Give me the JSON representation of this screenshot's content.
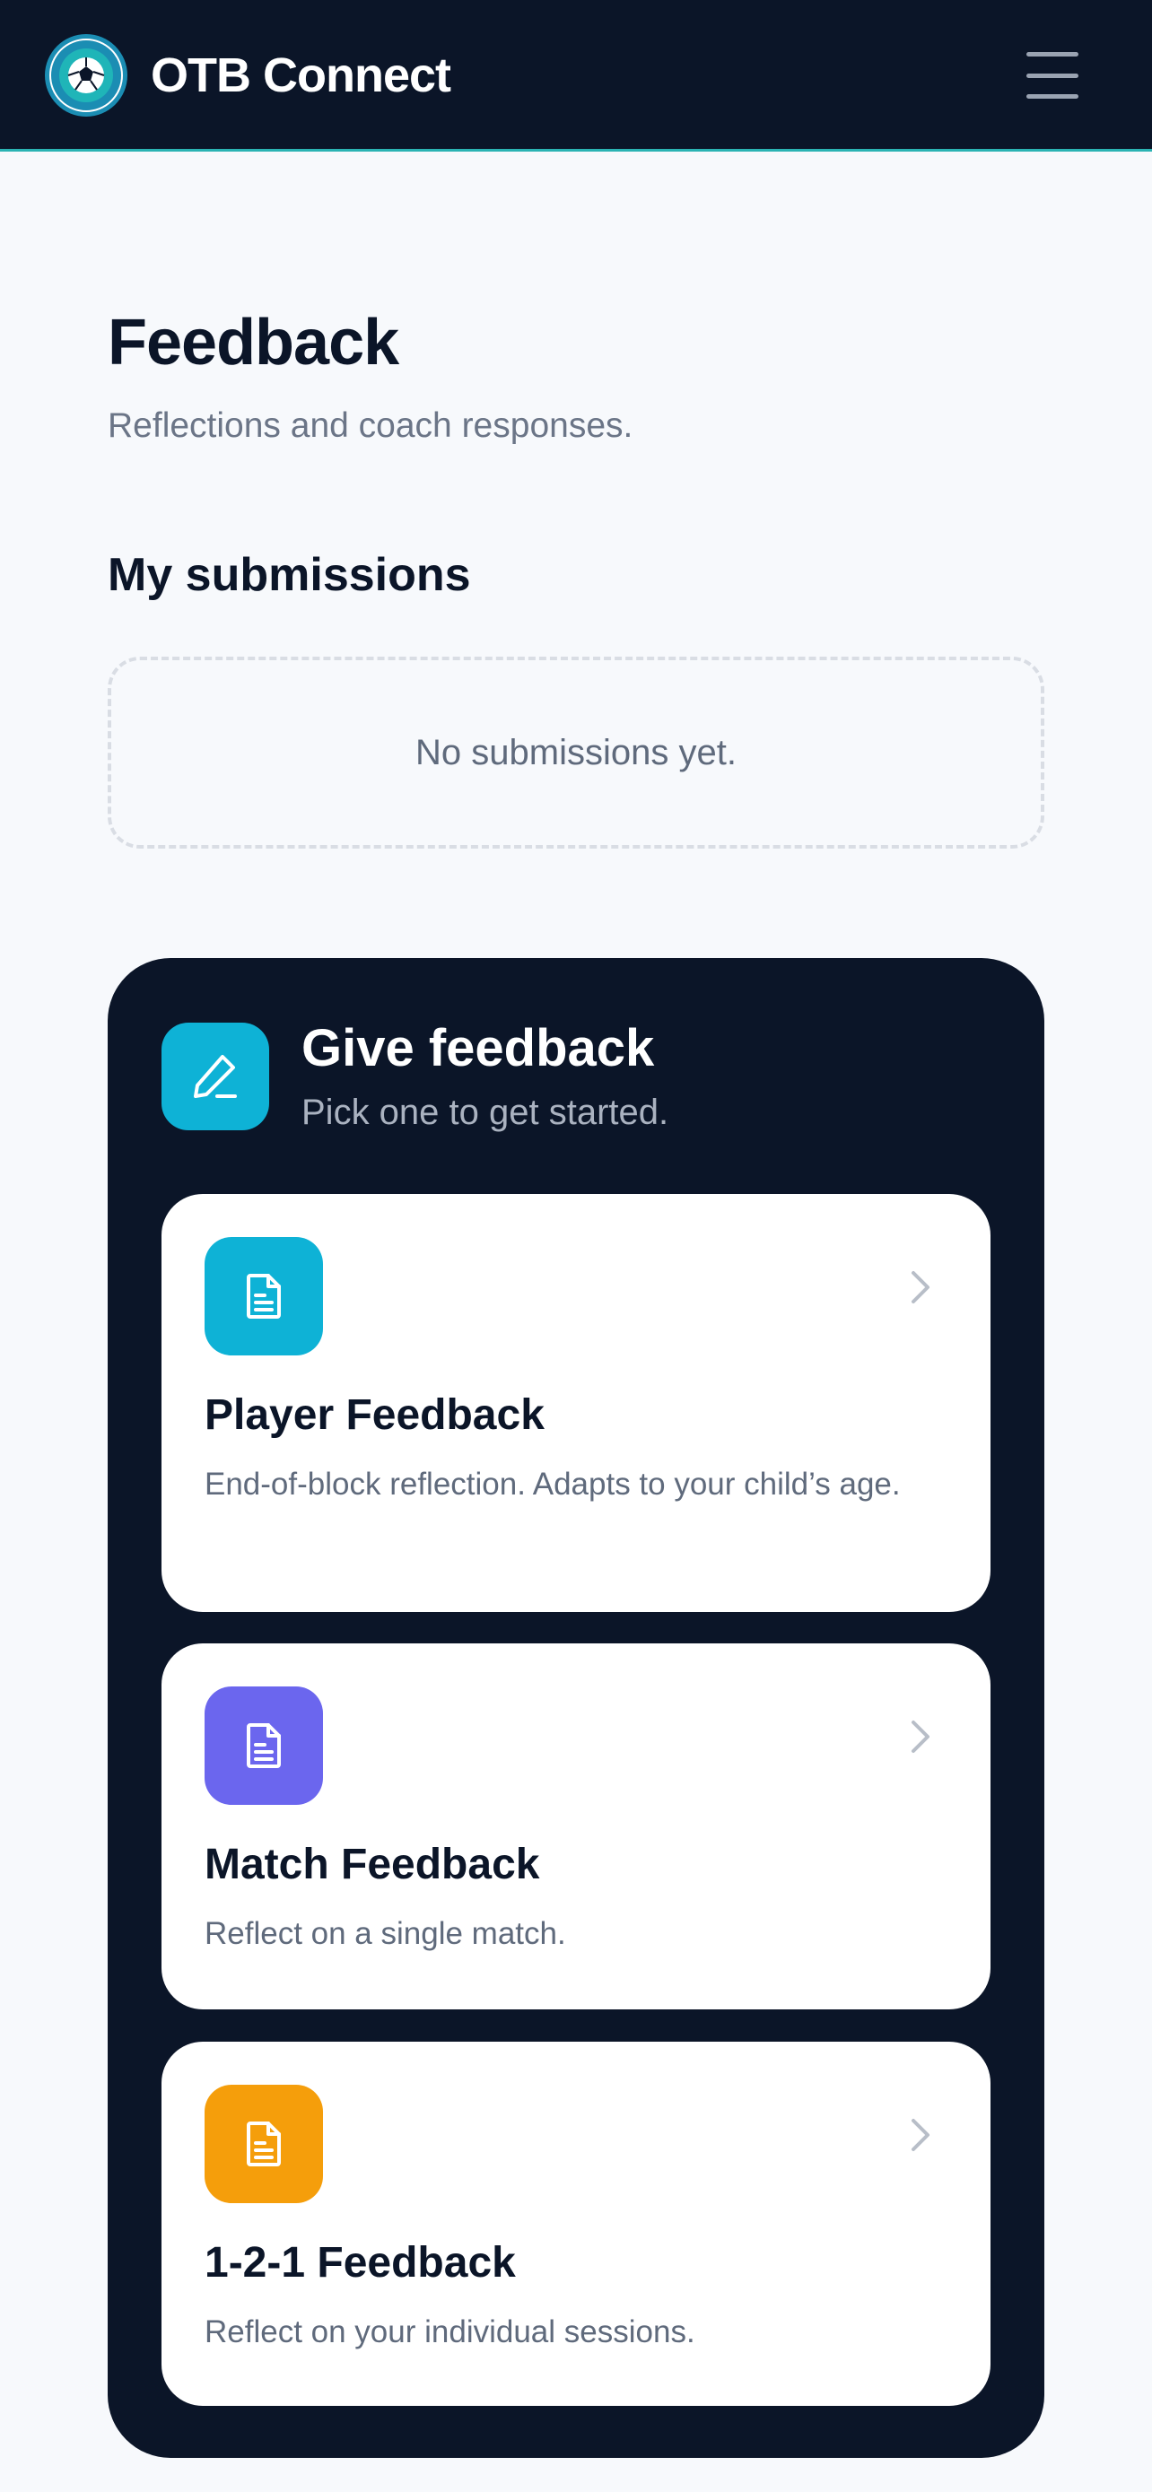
{
  "header": {
    "brand": "OTB Connect",
    "logo_icon": "soccer-ball-badge",
    "menu_icon": "hamburger-menu"
  },
  "page": {
    "title": "Feedback",
    "subtitle": "Reflections and coach responses."
  },
  "submissions": {
    "title": "My submissions",
    "empty_text": "No submissions yet."
  },
  "give_feedback": {
    "title": "Give feedback",
    "subtitle": "Pick one to get started.",
    "icon": "pencil-icon",
    "cards": [
      {
        "title": "Player Feedback",
        "description": "End-of-block reflection. Adapts to your child’s age.",
        "icon": "document-icon",
        "color": "#0eb2d6"
      },
      {
        "title": "Match Feedback",
        "description": "Reflect on a single match.",
        "icon": "document-icon",
        "color": "#6b66ee"
      },
      {
        "title": "1-2-1 Feedback",
        "description": "Reflect on your individual sessions.",
        "icon": "document-icon",
        "color": "#f59e0b"
      }
    ]
  },
  "colors": {
    "navy": "#0b1528",
    "teal_accent": "#2bb3b3",
    "cyan": "#0eb2d6",
    "purple": "#6b66ee",
    "orange": "#f59e0b"
  }
}
